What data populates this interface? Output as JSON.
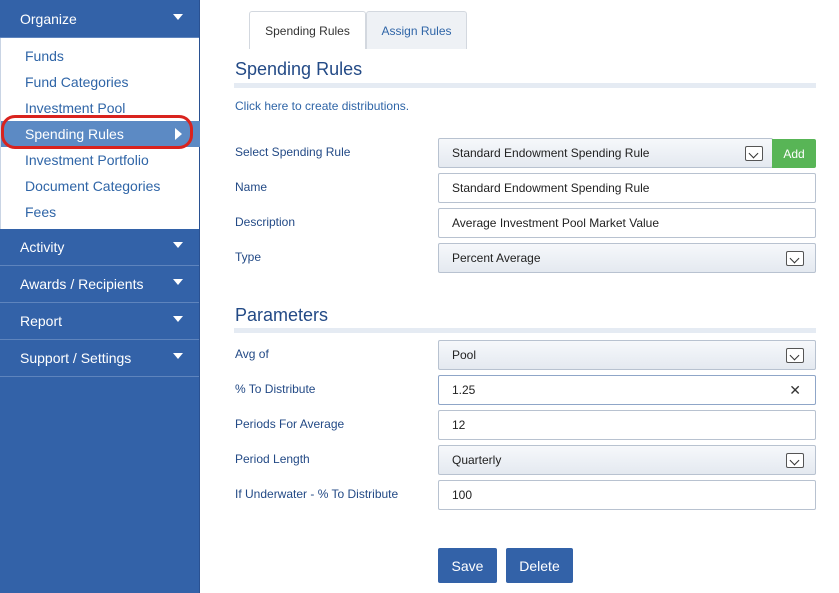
{
  "sidebar": {
    "organize": {
      "label": "Organize",
      "items": [
        {
          "label": "Funds"
        },
        {
          "label": "Fund Categories"
        },
        {
          "label": "Investment Pool"
        },
        {
          "label": "Spending Rules"
        },
        {
          "label": "Investment Portfolio"
        },
        {
          "label": "Document Categories"
        },
        {
          "label": "Fees"
        }
      ]
    },
    "sections": [
      {
        "label": "Activity"
      },
      {
        "label": "Awards / Recipients"
      },
      {
        "label": "Report"
      },
      {
        "label": "Support / Settings"
      }
    ]
  },
  "tabs": [
    {
      "label": "Spending Rules"
    },
    {
      "label": "Assign Rules"
    }
  ],
  "page": {
    "title": "Spending Rules",
    "create_link": "Click here to create distributions."
  },
  "form": {
    "select_rule": {
      "label": "Select Spending Rule",
      "value": "Standard Endowment Spending Rule"
    },
    "add_label": "Add",
    "name": {
      "label": "Name",
      "value": "Standard Endowment Spending Rule"
    },
    "description": {
      "label": "Description",
      "value": "Average Investment Pool Market Value"
    },
    "type": {
      "label": "Type",
      "value": "Percent Average"
    }
  },
  "parameters": {
    "title": "Parameters",
    "avg_of": {
      "label": "Avg of",
      "value": "Pool"
    },
    "pct_distribute": {
      "label": "% To Distribute",
      "value": "1.25"
    },
    "periods": {
      "label": "Periods For Average",
      "value": "12"
    },
    "period_length": {
      "label": "Period Length",
      "value": "Quarterly"
    },
    "underwater": {
      "label": "If Underwater - % To Distribute",
      "value": "100"
    }
  },
  "actions": {
    "save": "Save",
    "delete": "Delete"
  },
  "colors": {
    "sidebar": "#3362a8",
    "active_item": "#5c8ac4",
    "add_button": "#58b556",
    "highlight_ring": "#d9231e"
  }
}
